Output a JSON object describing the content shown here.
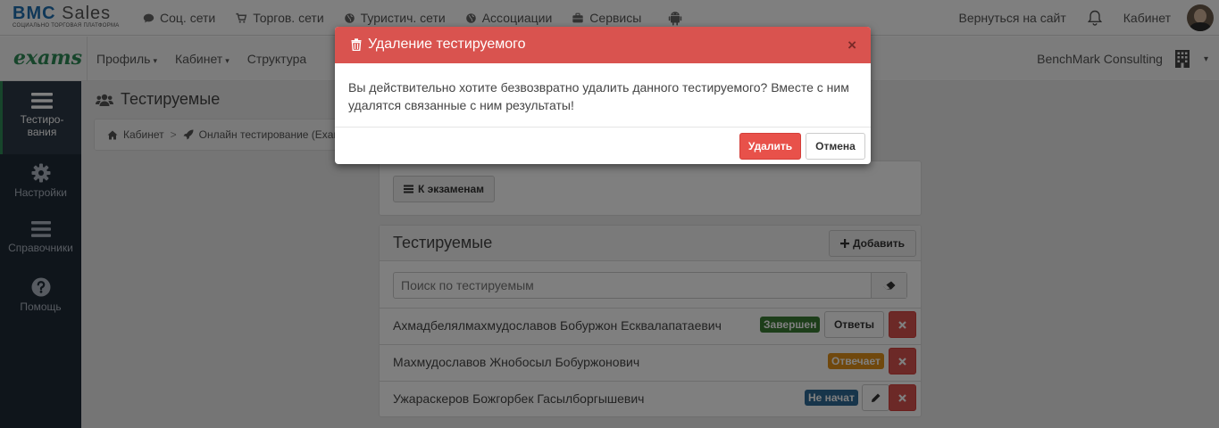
{
  "logo": {
    "brand_main": "BMC",
    "brand_suffix": "Sales",
    "tagline": "СОЦИАЛЬНО ТОРГОВАЯ ПЛАТФОРМА"
  },
  "topnav": {
    "items": [
      {
        "label": "Соц. сети",
        "icon": "comment-icon"
      },
      {
        "label": "Торгов. сети",
        "icon": "cart-icon"
      },
      {
        "label": "Туристич. сети",
        "icon": "globe-icon"
      },
      {
        "label": "Ассоциации",
        "icon": "globe-icon"
      },
      {
        "label": "Сервисы",
        "icon": "briefcase-icon"
      },
      {
        "label": "",
        "icon": "android-icon"
      }
    ],
    "back_link": "Вернуться на сайт",
    "cabinet": "Кабинет"
  },
  "navbar": {
    "brand": "exams",
    "items": [
      {
        "label": "Профиль",
        "caret": "▾"
      },
      {
        "label": "Кабинет",
        "caret": "▾"
      },
      {
        "label": "Структура",
        "caret": ""
      }
    ],
    "company": "BenchMark Consulting",
    "company_caret": "▾"
  },
  "sidebar": {
    "items": [
      {
        "label": "Тестиро-вания",
        "line1": "Тестиро-",
        "line2": "вания",
        "icon": "menu-icon",
        "active": true
      },
      {
        "label": "Настройки",
        "icon": "gear-icon"
      },
      {
        "label": "Справочники",
        "icon": "list-icon"
      },
      {
        "label": "Помощь",
        "icon": "help-icon"
      }
    ]
  },
  "page": {
    "title": "Тестируемые",
    "breadcrumb": [
      "Кабинет",
      "Онлайн тестирование (Exam"
    ],
    "back_button": "К экзаменам",
    "panel_title": "Тестируемые",
    "add_button": "Добавить",
    "search_placeholder": "Поиск по тестируемым"
  },
  "testees": [
    {
      "name": "Ахмадбелялмахмудославов Бобуржон Есквалапатаевич",
      "status": "Завершен",
      "status_color": "#3a7d35",
      "action": "Ответы"
    },
    {
      "name": "Махмудославов Жнобосыл Бобуржонович",
      "status": "Отвечает",
      "status_color": "#e0911a",
      "action": ""
    },
    {
      "name": "Ужараскеров Божгорбек Гасылборгышевич",
      "status": "Не начат",
      "status_color": "#2f6b97",
      "action": "edit"
    }
  ],
  "modal": {
    "title": "Удаление тестируемого",
    "close": "×",
    "body": "Вы действительно хотите безвозвратно удалить данного тестируемого? Вместе с ним удалятся связанные с ним результаты!",
    "confirm": "Удалить",
    "cancel": "Отмена",
    "header_color": "#d9534f"
  }
}
